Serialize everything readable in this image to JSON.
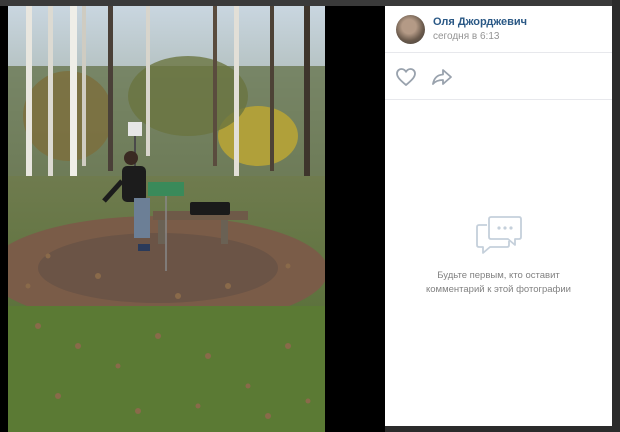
{
  "author": {
    "name": "Оля Джорджевич",
    "time": "сегодня в 6:13"
  },
  "actions": {
    "like_icon": "heart-icon",
    "share_icon": "share-arrow-icon"
  },
  "comments": {
    "empty_line1": "Будьте первым, кто оставит",
    "empty_line2": "комментарий к этой фотографии",
    "icon": "comments-bubble-icon"
  },
  "photo": {
    "description_icon": "photo"
  },
  "colors": {
    "link": "#2a5885",
    "muted": "#939393",
    "icon": "#99a2ad",
    "backdrop": "#2b2b2b"
  }
}
